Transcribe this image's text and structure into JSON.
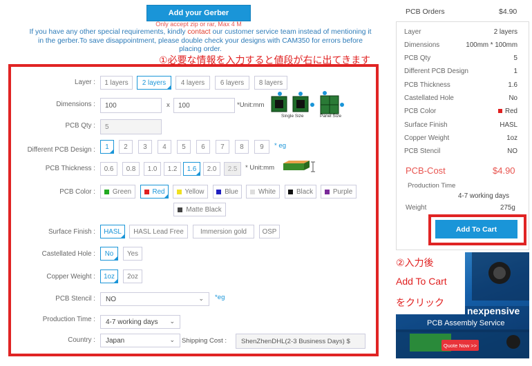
{
  "upload": {
    "button_label": "Add your Gerber",
    "accept_note": "Only accept zip or rar, Max 4 M",
    "info_before": "If you have any other special requirements, kindly ",
    "info_contact": "contact",
    "info_after": " our customer service team instead of mentioning it in the gerber.To save disappointment, please double check your designs with CAM350 for errors before placing order."
  },
  "annotations": {
    "note1": "①必要な情報を入力すると値段が右に出てきます",
    "note2_line1": "②入力後",
    "note2_line2": "Add To Cart",
    "note2_line3": "をクリック"
  },
  "form": {
    "layer": {
      "label": "Layer :",
      "options": [
        "1 layers",
        "2 layers",
        "4 layers",
        "6 layers",
        "8 layers"
      ],
      "selected": "2 layers"
    },
    "dimensions": {
      "label": "Dimensions :",
      "x_value": "100",
      "separator": "x",
      "y_value": "100",
      "unit": "*Unit:mm",
      "single_size": "Single Size",
      "panel_size": "Panel Size"
    },
    "qty": {
      "label": "PCB Qty :",
      "value": "5"
    },
    "design": {
      "label": "Different PCB Design :",
      "options": [
        "1",
        "2",
        "3",
        "4",
        "5",
        "6",
        "7",
        "8",
        "9"
      ],
      "selected": "1",
      "eg": "* eg"
    },
    "thickness": {
      "label": "PCB Thickness :",
      "options": [
        "0.6",
        "0.8",
        "1.0",
        "1.2",
        "1.6",
        "2.0",
        "2.5"
      ],
      "selected": "1.6",
      "disabled": "2.5",
      "unit": "* Unit:mm"
    },
    "color": {
      "label": "PCB Color :",
      "options": [
        {
          "name": "Green",
          "color": "#22aa22"
        },
        {
          "name": "Red",
          "color": "#e02020"
        },
        {
          "name": "Yellow",
          "color": "#f0e020"
        },
        {
          "name": "Blue",
          "color": "#2020c0"
        },
        {
          "name": "White",
          "color": "#dddddd"
        },
        {
          "name": "Black",
          "color": "#111111"
        },
        {
          "name": "Purple",
          "color": "#7a2a9a"
        },
        {
          "name": "Matte Black",
          "color": "#444444"
        }
      ],
      "selected": "Red"
    },
    "finish": {
      "label": "Surface Finish :",
      "options": [
        "HASL",
        "HASL Lead Free",
        "Immersion gold",
        "OSP"
      ],
      "selected": "HASL"
    },
    "castellated": {
      "label": "Castellated Hole :",
      "options": [
        "No",
        "Yes"
      ],
      "selected": "No"
    },
    "copper": {
      "label": "Copper Weight :",
      "options": [
        "1oz",
        "2oz"
      ],
      "selected": "1oz"
    },
    "stencil": {
      "label": "PCB Stencil :",
      "value": "NO",
      "eg": "*eg"
    },
    "production": {
      "label": "Production Time :",
      "value": "4-7 working days"
    },
    "country": {
      "label": "Country :",
      "value": "Japan"
    },
    "shipping": {
      "label": "Shipping Cost :",
      "value": "ShenZhenDHL(2-3 Business Days) $"
    }
  },
  "summary": {
    "title": "PCB Orders",
    "total": "$4.90",
    "rows": [
      {
        "label": "Layer",
        "value": "2 layers"
      },
      {
        "label": "Dimensions",
        "value": "100mm * 100mm"
      },
      {
        "label": "PCB Qty",
        "value": "5"
      },
      {
        "label": "Different PCB Design",
        "value": "1"
      },
      {
        "label": "PCB Thickness",
        "value": "1.6"
      },
      {
        "label": "Castellated Hole",
        "value": "No"
      },
      {
        "label": "PCB Color",
        "value": "Red"
      },
      {
        "label": "Surface Finish",
        "value": "HASL"
      },
      {
        "label": "Copper Weight",
        "value": "1oz"
      },
      {
        "label": "PCB Stencil",
        "value": "NO"
      }
    ],
    "cost_label": "PCB-Cost",
    "cost_value": "$4.90",
    "production_label": "Production Time",
    "production_value": "4-7 working days",
    "weight_label": "Weight",
    "weight_value": "275g",
    "cart_button": "Add To Cart"
  },
  "ad": {
    "headline": "nexpensive",
    "subline": "PCB Assembly Service",
    "button": "Quote Now >>"
  }
}
